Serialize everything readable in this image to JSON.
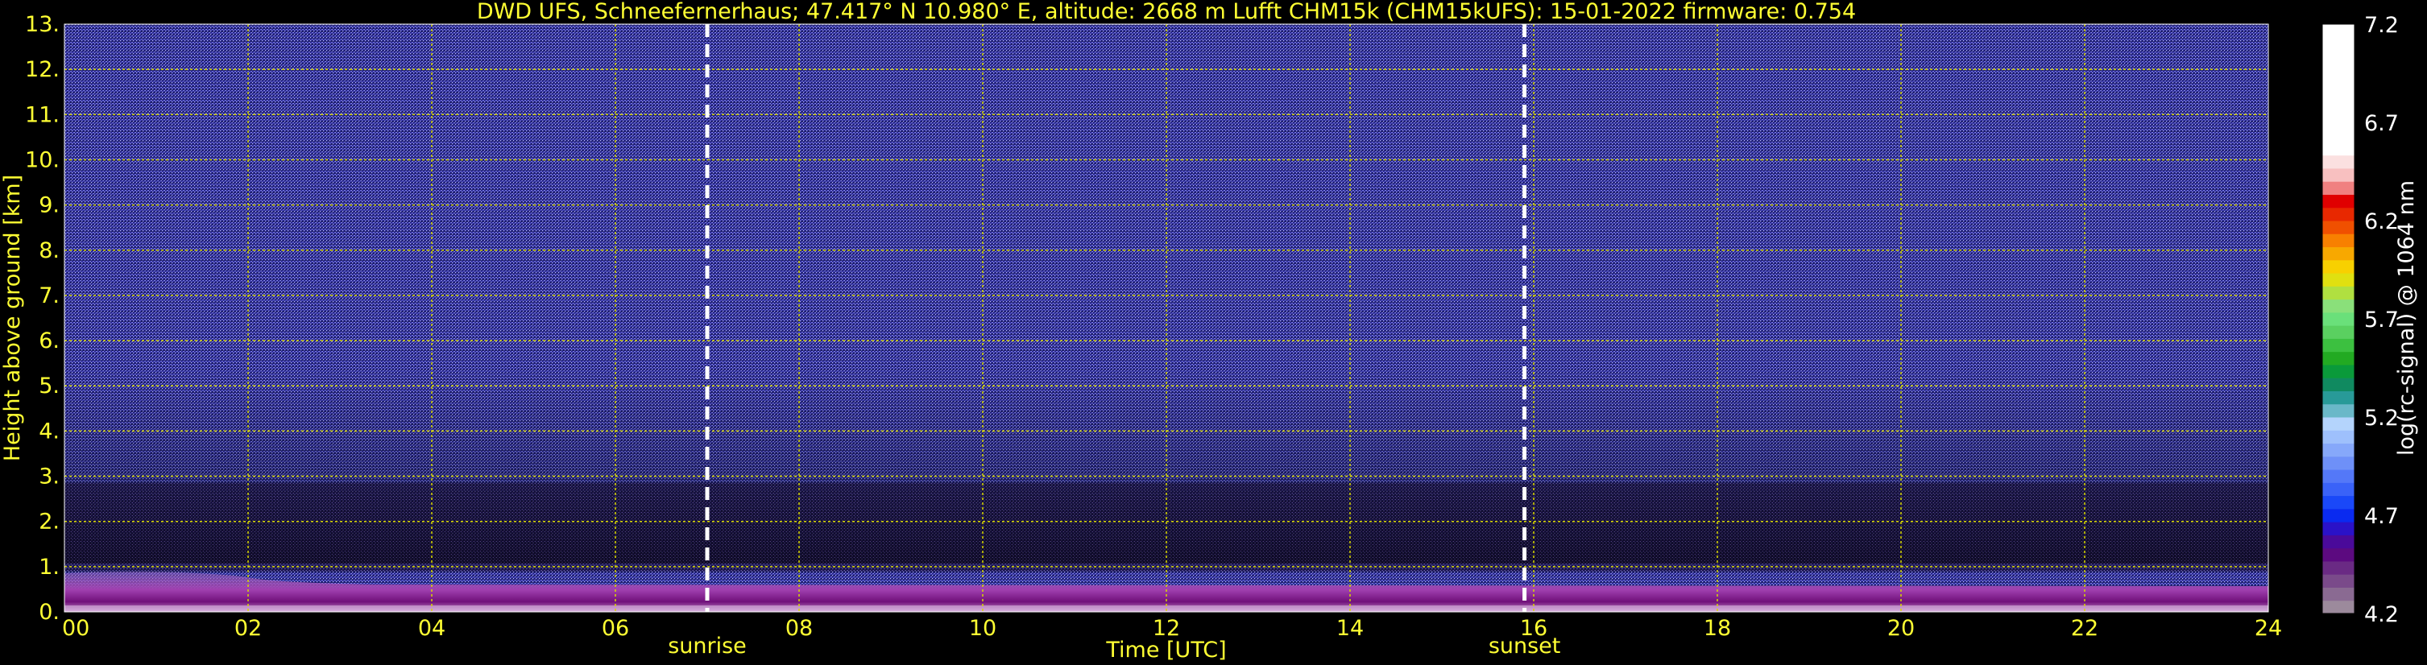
{
  "chart_data": {
    "type": "heatmap",
    "title": "DWD UFS, Schneefernerhaus; 47.417° N 10.980° E, altitude: 2668 m    Lufft CHM15k (CHM15kUFS): 15-01-2022    firmware: 0.754",
    "xlabel": "Time [UTC]",
    "ylabel": "Height above ground [km]",
    "xlim": [
      0,
      24
    ],
    "ylim": [
      0,
      13
    ],
    "x_ticks": [
      "00",
      "02",
      "04",
      "06",
      "08",
      "10",
      "12",
      "14",
      "16",
      "18",
      "20",
      "22",
      "24"
    ],
    "y_ticks": [
      "0.",
      "1.",
      "2.",
      "3.",
      "4.",
      "5.",
      "6.",
      "7.",
      "8.",
      "9.",
      "10.",
      "11.",
      "12.",
      "13."
    ],
    "grid": true,
    "events": [
      {
        "label": "sunrise",
        "time": 7.0
      },
      {
        "label": "sunset",
        "time": 15.9
      }
    ],
    "colorbar": {
      "label": "log(rc-signal) @ 1064 nm",
      "range": [
        4.2,
        7.2
      ],
      "ticks": [
        "4.2",
        "4.7",
        "5.2",
        "5.7",
        "6.2",
        "6.7",
        "7.2"
      ]
    }
  }
}
